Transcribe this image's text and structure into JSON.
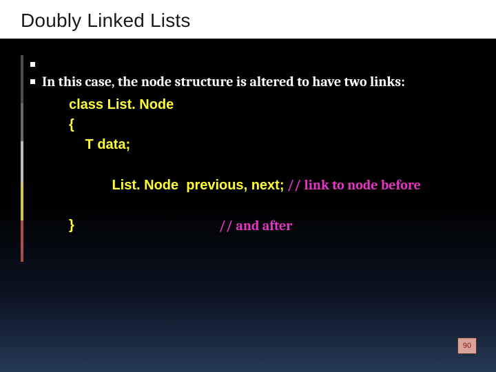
{
  "slide": {
    "title": "Doubly Linked Lists",
    "bullet_empty": "",
    "bullet_main": "In this case, the node structure is altered to have two links:",
    "code": {
      "l1": "class List. Node",
      "l2": "{",
      "l3": " T data;",
      "l4_code": "List. Node  previous, next;",
      "l4_comment": " // link to node before",
      "l5_close": "}",
      "l5_comment": "// and after"
    },
    "page_number": "90"
  }
}
